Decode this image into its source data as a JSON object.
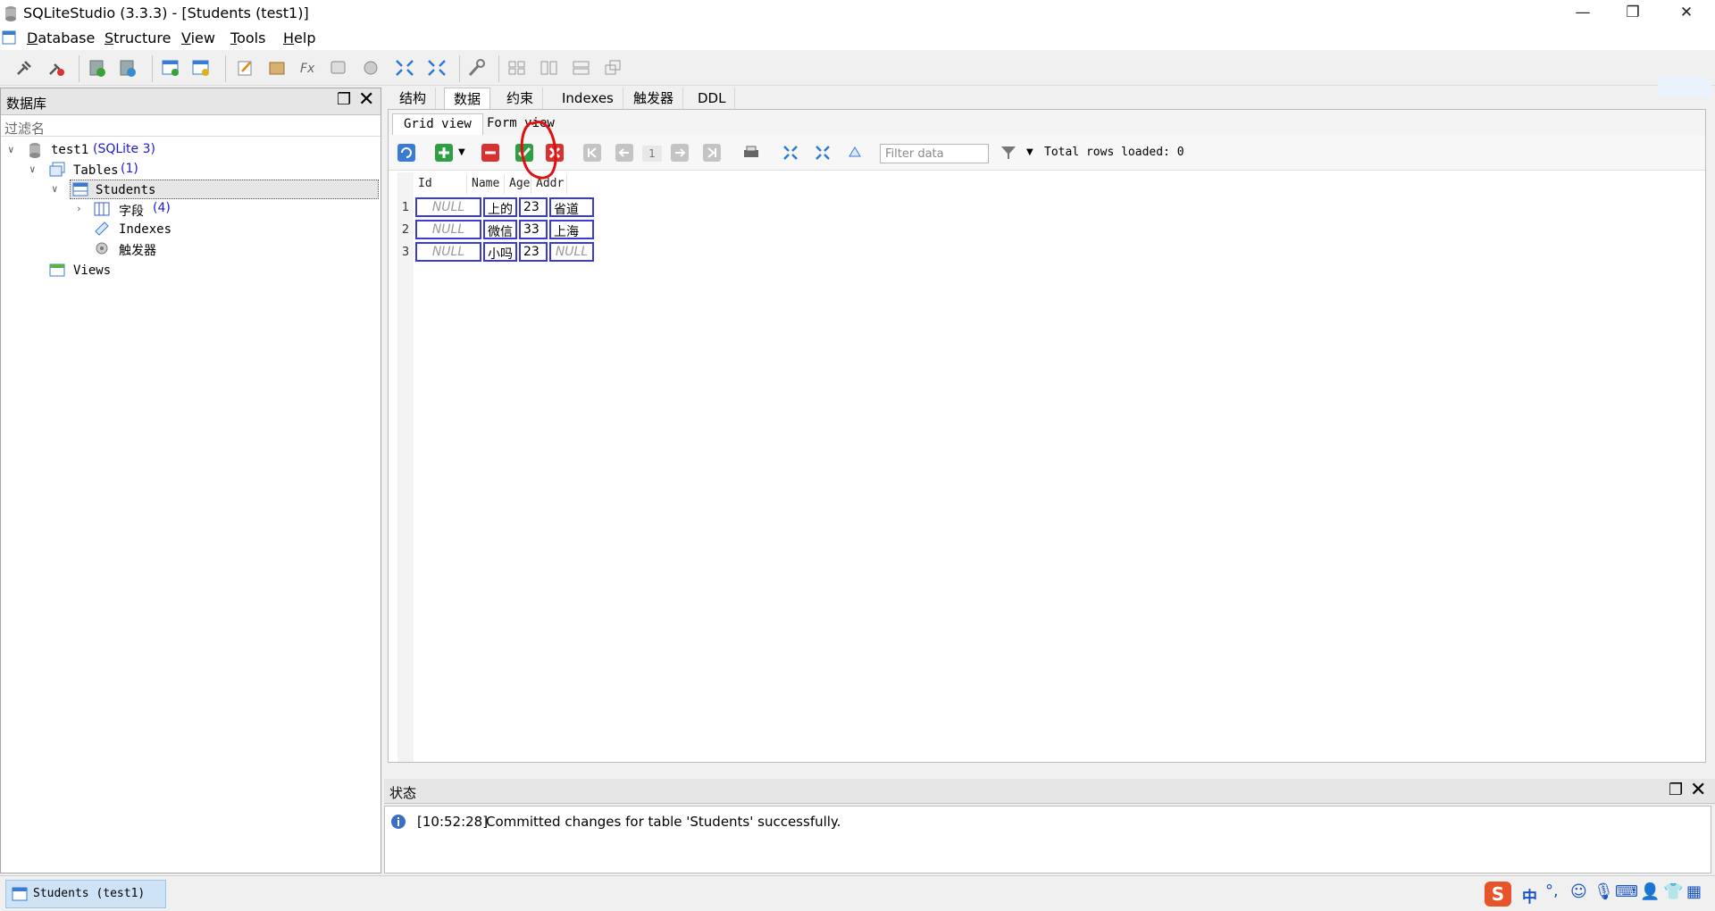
{
  "window": {
    "title": "SQLiteStudio (3.3.3) - [Students (test1)]"
  },
  "menu": [
    {
      "label_u": "D",
      "label_rest": "atabase"
    },
    {
      "label_u": "S",
      "label_rest": "tructure"
    },
    {
      "label_u": "V",
      "label_rest": "iew"
    },
    {
      "label_u": "T",
      "label_rest": "ools"
    },
    {
      "label_u": "H",
      "label_rest": "elp"
    }
  ],
  "left_panel": {
    "title": "数据库",
    "filter_placeholder": "过滤名",
    "db_name": "test1",
    "db_type": "(SQLite 3)",
    "tables_label": "Tables",
    "tables_count": "(1)",
    "table_name": "Students",
    "columns_label": "字段",
    "columns_count": "(4)",
    "indexes_label": "Indexes",
    "triggers_label": "触发器",
    "views_label": "Views"
  },
  "tabs": [
    "结构",
    "数据",
    "约束",
    "Indexes",
    "触发器",
    "DDL"
  ],
  "active_tab": "数据",
  "subtabs": [
    "Grid view",
    "Form view"
  ],
  "grid_toolbar": {
    "page_number": "1",
    "filter_placeholder": "Filter data",
    "total_rows": "Total rows loaded: 0"
  },
  "grid": {
    "columns": [
      "Id",
      "Name",
      "Age",
      "Addr"
    ],
    "rows": [
      {
        "num": "1",
        "id": "NULL",
        "name": "上的",
        "age": "23",
        "addr": "省道"
      },
      {
        "num": "2",
        "id": "NULL",
        "name": "微信",
        "age": "33",
        "addr": "上海"
      },
      {
        "num": "3",
        "id": "NULL",
        "name": "小吗",
        "age": "23",
        "addr": "NULL"
      }
    ]
  },
  "status_panel": {
    "title": "状态",
    "time": "[10:52:28]",
    "message": "Committed changes for table 'Students' successfully."
  },
  "taskbar": {
    "window_label": "Students (test1)"
  },
  "tray": {
    "ime_label": "中"
  },
  "colors": {
    "accent": "#1a1ad2",
    "cell_border": "#3a3ad8",
    "annotation": "#e01010"
  }
}
